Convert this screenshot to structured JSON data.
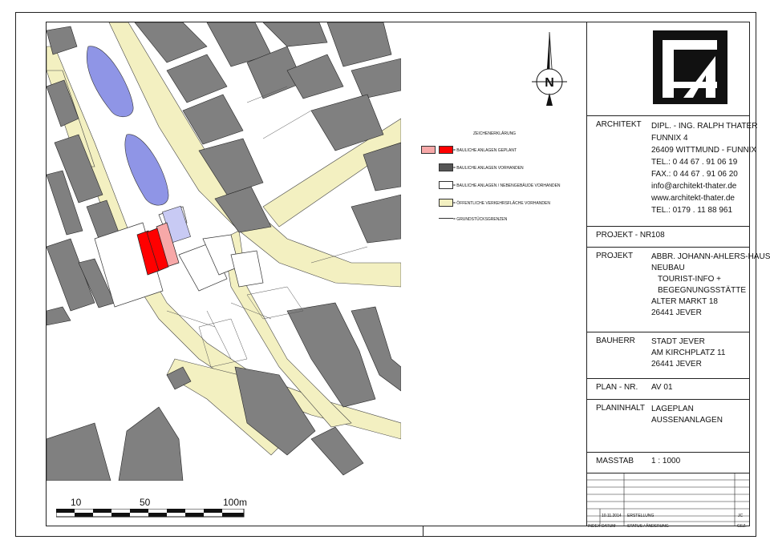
{
  "colors": {
    "building_existing": "#808080",
    "building_planned_dark": "#ff0000",
    "building_planned_light": "#f7a8a8",
    "traffic_area": "#f3f0c1",
    "water": "#8f95e6",
    "annex_blue": "#c8caf4",
    "line": "#222222"
  },
  "icons": {
    "north": "north-arrow-icon",
    "logo": "architect-logo-icon"
  },
  "legend": {
    "title": "ZEICHENERKLÄRUNG",
    "items": [
      {
        "text": "= BAULICHE ANLAGEN GEPLANT",
        "swatch": "planned"
      },
      {
        "text": "= BAULICHE ANLAGEN VORHANDEN",
        "swatch": "existing"
      },
      {
        "text": "= BAULICHE ANLAGEN / NEBENGEBÄUDE VORHANDEN",
        "swatch": "annex"
      },
      {
        "text": "= ÖFFENTLICHE VERKEHRSFLÄCHE VORHANDEN",
        "swatch": "traffic"
      },
      {
        "text": "= GRUNDSTÜCKSGRENZEN",
        "swatch": "line"
      }
    ]
  },
  "north_label": "N",
  "scale": {
    "labels": [
      "10",
      "50",
      "100m"
    ]
  },
  "titleblock": {
    "architekt": {
      "label": "ARCHITEKT",
      "lines": [
        "DIPL. - ING. RALPH THATER",
        "FUNNIX 4",
        "26409 WITTMUND - FUNNIX",
        "TEL.: 0 44 67 . 91 06 19",
        "FAX.: 0 44 67 . 91 06 20",
        "info@architekt-thater.de",
        "www.architekt-thater.de",
        "TEL.: 0179 . 11 88 961"
      ]
    },
    "projekt_nr": {
      "label": "PROJEKT - NR.",
      "value": "108"
    },
    "projekt": {
      "label": "PROJEKT",
      "lines": [
        "ABBR. JOHANN-AHLERS-HAUS",
        "NEUBAU",
        "TOURIST-INFO +",
        "BEGEGNUNGSSTÄTTE",
        "ALTER MARKT 18",
        "26441 JEVER"
      ]
    },
    "bauherr": {
      "label": "BAUHERR",
      "lines": [
        "STADT JEVER",
        "AM KIRCHPLATZ 11",
        "26441 JEVER"
      ]
    },
    "plan_nr": {
      "label": "PLAN - NR.",
      "value": "AV 01"
    },
    "planinhalt": {
      "label": "PLANINHALT",
      "lines": [
        "LAGEPLAN",
        "AUSSENANLAGEN"
      ]
    },
    "masstab": {
      "label": "MASSTAB",
      "value": "1 : 1000"
    },
    "revision": {
      "date": "10.11.2014",
      "status": "ERSTELLUNG",
      "by": "JC",
      "head_index": "INDEX",
      "head_date": "DATUM",
      "head_status": "STATUS / ÄNDERUNG",
      "head_by": "GEZ."
    }
  }
}
